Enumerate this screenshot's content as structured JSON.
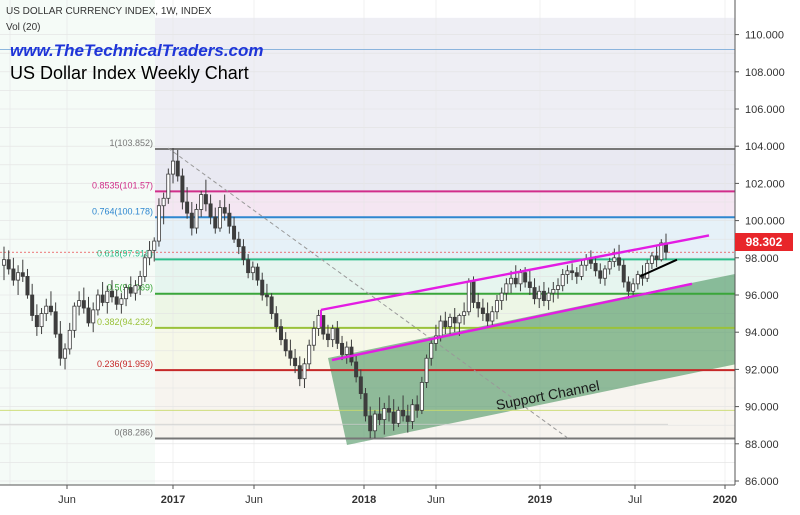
{
  "header": {
    "title": "US DOLLAR CURRENCY INDEX, 1W, INDEX",
    "vol": "Vol (20)",
    "website": "www.TheTechnicalTraders.com",
    "chart_title": "US Dollar Index Weekly Chart"
  },
  "last_price": "98.302",
  "colors": {
    "candle": "#3d3d3d",
    "channel": "#e31ce3",
    "support_fill": "#3a8a52",
    "price_tag": "#e8262a"
  },
  "chart_data": {
    "type": "candlestick",
    "title": "US Dollar Index Weekly Chart",
    "ylim": [
      86.0,
      111.0
    ],
    "y_ticks": [
      "110.000",
      "108.000",
      "106.000",
      "104.000",
      "102.000",
      "100.000",
      "98.000",
      "96.000",
      "94.000",
      "92.000",
      "90.000",
      "88.000",
      "86.000"
    ],
    "x_ticks": [
      "Jun",
      "2017",
      "Jun",
      "2018",
      "Jun",
      "2019",
      "Jul",
      "2020"
    ],
    "fib_levels": [
      {
        "label": "1(103.852)",
        "value": 103.852,
        "color": "#777777"
      },
      {
        "label": "0.8535(101.57)",
        "value": 101.57,
        "color": "#d12d8a"
      },
      {
        "label": "0.764(100.178)",
        "value": 100.178,
        "color": "#2e87d0"
      },
      {
        "label": "0.618(97.916)",
        "value": 97.916,
        "color": "#2dbd8a"
      },
      {
        "label": "0.5(96.069)",
        "value": 96.069,
        "color": "#3aa63a"
      },
      {
        "label": "0.382(94.232)",
        "value": 94.232,
        "color": "#9ac23a"
      },
      {
        "label": "0.236(91.959)",
        "value": 91.959,
        "color": "#c62828"
      },
      {
        "label": "0(88.286)",
        "value": 88.286,
        "color": "#777777"
      }
    ],
    "last_price": 98.302,
    "annotations": [
      "Support Channel"
    ],
    "candles": [
      [
        97.6,
        98.6,
        96.8,
        97.9
      ],
      [
        97.9,
        98.4,
        97.1,
        97.4
      ],
      [
        97.4,
        98.0,
        96.5,
        96.8
      ],
      [
        96.8,
        97.6,
        96.0,
        97.2
      ],
      [
        97.2,
        97.9,
        96.7,
        97.0
      ],
      [
        97.0,
        97.4,
        95.8,
        96.0
      ],
      [
        96.0,
        96.6,
        94.6,
        94.9
      ],
      [
        94.9,
        95.5,
        93.8,
        94.3
      ],
      [
        94.3,
        95.3,
        93.9,
        95.0
      ],
      [
        95.0,
        95.8,
        94.6,
        95.4
      ],
      [
        95.4,
        96.2,
        94.9,
        95.1
      ],
      [
        95.1,
        95.6,
        93.7,
        93.9
      ],
      [
        93.9,
        94.6,
        92.2,
        92.6
      ],
      [
        92.6,
        93.4,
        92.0,
        93.1
      ],
      [
        93.1,
        94.5,
        92.8,
        94.1
      ],
      [
        94.1,
        95.6,
        93.7,
        95.4
      ],
      [
        95.4,
        96.2,
        94.9,
        95.7
      ],
      [
        95.7,
        96.4,
        95.0,
        95.3
      ],
      [
        95.3,
        95.9,
        94.3,
        94.5
      ],
      [
        94.5,
        95.6,
        94.0,
        95.2
      ],
      [
        95.2,
        96.3,
        94.9,
        96.0
      ],
      [
        96.0,
        96.7,
        95.4,
        95.6
      ],
      [
        95.6,
        96.5,
        95.0,
        96.2
      ],
      [
        96.2,
        96.8,
        95.6,
        95.9
      ],
      [
        95.9,
        96.3,
        95.2,
        95.5
      ],
      [
        95.5,
        96.1,
        95.0,
        95.8
      ],
      [
        95.8,
        96.6,
        95.4,
        96.4
      ],
      [
        96.4,
        97.0,
        95.9,
        96.1
      ],
      [
        96.1,
        96.8,
        95.7,
        96.5
      ],
      [
        96.5,
        97.3,
        96.0,
        97.0
      ],
      [
        97.0,
        98.2,
        96.7,
        98.0
      ],
      [
        98.0,
        98.9,
        97.6,
        98.4
      ],
      [
        98.4,
        99.1,
        97.8,
        98.9
      ],
      [
        98.9,
        101.2,
        98.6,
        100.8
      ],
      [
        100.8,
        101.5,
        99.8,
        101.2
      ],
      [
        101.2,
        102.8,
        100.9,
        102.5
      ],
      [
        102.5,
        103.9,
        102.0,
        103.2
      ],
      [
        103.2,
        103.8,
        102.1,
        102.4
      ],
      [
        102.4,
        102.8,
        100.6,
        101.0
      ],
      [
        101.0,
        101.8,
        100.1,
        100.4
      ],
      [
        100.4,
        101.0,
        99.2,
        99.6
      ],
      [
        99.6,
        100.9,
        99.3,
        100.6
      ],
      [
        100.6,
        101.6,
        100.2,
        101.4
      ],
      [
        101.4,
        102.2,
        100.5,
        100.9
      ],
      [
        100.9,
        101.4,
        99.8,
        100.2
      ],
      [
        100.2,
        100.7,
        99.3,
        99.6
      ],
      [
        99.6,
        101.1,
        99.4,
        100.7
      ],
      [
        100.7,
        101.4,
        100.0,
        100.4
      ],
      [
        100.4,
        100.9,
        99.3,
        99.7
      ],
      [
        99.7,
        100.2,
        98.8,
        99.0
      ],
      [
        99.0,
        99.4,
        98.2,
        98.6
      ],
      [
        98.6,
        99.0,
        97.6,
        97.9
      ],
      [
        97.9,
        98.2,
        96.9,
        97.2
      ],
      [
        97.2,
        97.8,
        96.8,
        97.5
      ],
      [
        97.5,
        97.7,
        96.5,
        96.8
      ],
      [
        96.8,
        97.2,
        95.7,
        96.0
      ],
      [
        96.0,
        96.6,
        95.4,
        95.9
      ],
      [
        95.9,
        96.1,
        94.7,
        95.0
      ],
      [
        95.0,
        95.4,
        94.0,
        94.3
      ],
      [
        94.3,
        94.7,
        93.3,
        93.6
      ],
      [
        93.6,
        94.0,
        92.7,
        93.0
      ],
      [
        93.0,
        93.6,
        92.2,
        92.6
      ],
      [
        92.6,
        93.1,
        91.8,
        92.2
      ],
      [
        92.2,
        92.7,
        91.1,
        91.5
      ],
      [
        91.5,
        92.6,
        91.0,
        92.3
      ],
      [
        92.3,
        93.6,
        92.0,
        93.3
      ],
      [
        93.3,
        94.6,
        93.0,
        94.2
      ],
      [
        94.2,
        95.2,
        93.8,
        94.9
      ],
      [
        94.9,
        94.9,
        93.6,
        93.9
      ],
      [
        93.9,
        94.4,
        93.2,
        93.6
      ],
      [
        93.6,
        94.4,
        93.2,
        94.2
      ],
      [
        94.2,
        94.6,
        93.1,
        93.4
      ],
      [
        93.4,
        93.8,
        92.5,
        92.8
      ],
      [
        92.8,
        93.5,
        92.3,
        93.2
      ],
      [
        93.2,
        93.6,
        92.2,
        92.4
      ],
      [
        92.4,
        92.8,
        91.3,
        91.6
      ],
      [
        91.6,
        92.0,
        90.4,
        90.7
      ],
      [
        90.7,
        91.0,
        89.2,
        89.5
      ],
      [
        89.5,
        90.0,
        88.3,
        88.7
      ],
      [
        88.7,
        89.8,
        88.3,
        89.6
      ],
      [
        89.6,
        90.5,
        89.0,
        89.3
      ],
      [
        89.3,
        90.2,
        88.5,
        89.9
      ],
      [
        89.9,
        90.6,
        89.2,
        89.7
      ],
      [
        89.7,
        90.4,
        88.7,
        89.1
      ],
      [
        89.1,
        90.0,
        88.9,
        89.8
      ],
      [
        89.8,
        90.6,
        89.2,
        89.5
      ],
      [
        89.5,
        90.1,
        88.6,
        89.2
      ],
      [
        89.2,
        90.4,
        88.8,
        90.1
      ],
      [
        90.1,
        90.6,
        89.4,
        89.8
      ],
      [
        89.8,
        91.6,
        89.6,
        91.3
      ],
      [
        91.3,
        92.8,
        91.0,
        92.6
      ],
      [
        92.6,
        93.6,
        92.2,
        93.4
      ],
      [
        93.4,
        94.4,
        93.0,
        93.8
      ],
      [
        93.8,
        94.9,
        93.5,
        94.6
      ],
      [
        94.6,
        95.1,
        93.9,
        94.3
      ],
      [
        94.3,
        95.0,
        93.9,
        94.8
      ],
      [
        94.8,
        95.3,
        94.0,
        94.5
      ],
      [
        94.5,
        95.0,
        93.8,
        94.9
      ],
      [
        94.9,
        95.6,
        94.4,
        95.1
      ],
      [
        95.1,
        96.9,
        94.9,
        96.7
      ],
      [
        96.7,
        97.0,
        95.3,
        95.6
      ],
      [
        95.6,
        96.1,
        94.8,
        95.3
      ],
      [
        95.3,
        95.8,
        94.6,
        95.0
      ],
      [
        95.0,
        95.6,
        94.3,
        94.6
      ],
      [
        94.6,
        95.4,
        94.3,
        95.1
      ],
      [
        95.1,
        96.0,
        94.7,
        95.7
      ],
      [
        95.7,
        96.4,
        95.2,
        96.1
      ],
      [
        96.1,
        96.9,
        95.7,
        96.6
      ],
      [
        96.6,
        97.3,
        96.1,
        96.9
      ],
      [
        96.9,
        97.6,
        96.4,
        96.6
      ],
      [
        96.6,
        97.4,
        96.2,
        97.2
      ],
      [
        97.2,
        97.5,
        96.4,
        96.7
      ],
      [
        96.7,
        97.3,
        96.0,
        96.4
      ],
      [
        96.4,
        96.9,
        95.5,
        95.8
      ],
      [
        95.8,
        96.5,
        95.3,
        96.2
      ],
      [
        96.2,
        96.7,
        95.4,
        95.7
      ],
      [
        95.7,
        96.4,
        95.2,
        96.1
      ],
      [
        96.1,
        96.7,
        95.6,
        96.3
      ],
      [
        96.3,
        96.9,
        95.8,
        96.5
      ],
      [
        96.5,
        97.4,
        96.2,
        97.1
      ],
      [
        97.1,
        97.6,
        96.6,
        97.3
      ],
      [
        97.3,
        97.7,
        96.8,
        97.2
      ],
      [
        97.2,
        97.5,
        96.6,
        97.0
      ],
      [
        97.0,
        97.9,
        96.8,
        97.6
      ],
      [
        97.6,
        98.2,
        97.3,
        97.9
      ],
      [
        97.9,
        98.4,
        97.4,
        97.7
      ],
      [
        97.7,
        98.1,
        97.0,
        97.3
      ],
      [
        97.3,
        97.7,
        96.6,
        96.9
      ],
      [
        96.9,
        97.6,
        96.5,
        97.4
      ],
      [
        97.4,
        98.0,
        97.1,
        97.8
      ],
      [
        97.8,
        98.5,
        97.5,
        98.0
      ],
      [
        98.0,
        98.7,
        97.3,
        97.6
      ],
      [
        97.6,
        97.9,
        96.4,
        96.7
      ],
      [
        96.7,
        97.0,
        95.8,
        96.2
      ],
      [
        96.2,
        96.9,
        95.9,
        96.6
      ],
      [
        96.6,
        97.3,
        96.3,
        97.1
      ],
      [
        97.1,
        97.6,
        96.5,
        96.9
      ],
      [
        96.9,
        97.9,
        96.7,
        97.7
      ],
      [
        97.7,
        98.3,
        97.4,
        98.1
      ],
      [
        98.1,
        98.6,
        97.5,
        97.9
      ],
      [
        97.9,
        99.0,
        97.8,
        98.8
      ],
      [
        98.8,
        99.3,
        97.9,
        98.3
      ]
    ]
  }
}
